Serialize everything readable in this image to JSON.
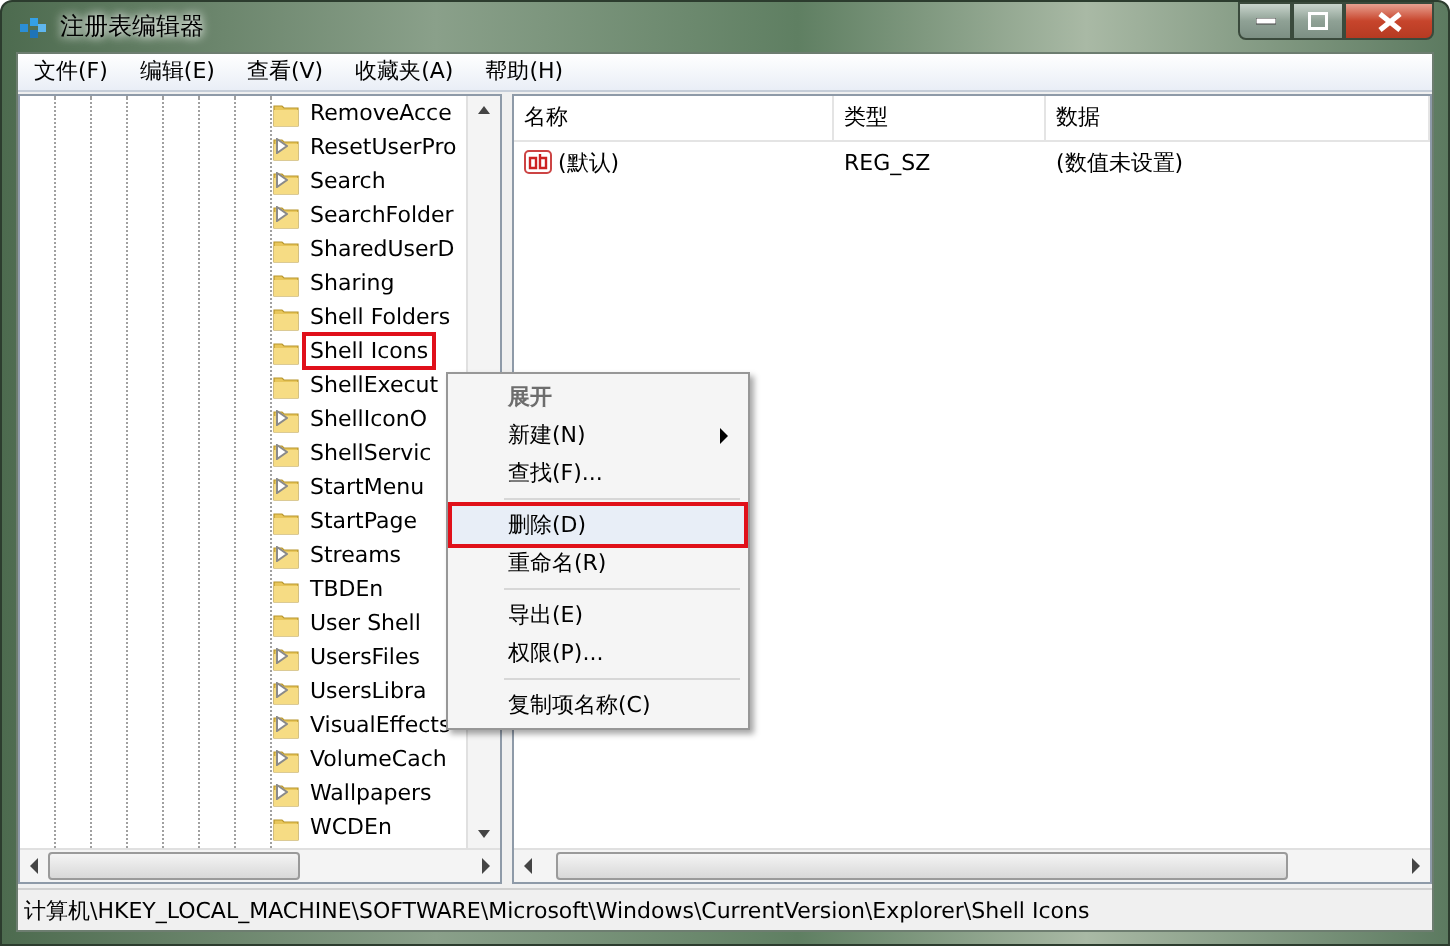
{
  "window": {
    "title": "注册表编辑器"
  },
  "menu_bar": [
    "文件(F)",
    "编辑(E)",
    "查看(V)",
    "收藏夹(A)",
    "帮助(H)"
  ],
  "tree": {
    "items": [
      {
        "label": "RemoveAcce",
        "expandable": false,
        "selected": false
      },
      {
        "label": "ResetUserPro",
        "expandable": true,
        "selected": false
      },
      {
        "label": "Search",
        "expandable": true,
        "selected": false
      },
      {
        "label": "SearchFolder",
        "expandable": true,
        "selected": false
      },
      {
        "label": "SharedUserD",
        "expandable": false,
        "selected": false
      },
      {
        "label": "Sharing",
        "expandable": false,
        "selected": false
      },
      {
        "label": "Shell Folders",
        "expandable": false,
        "selected": false
      },
      {
        "label": "Shell Icons",
        "expandable": false,
        "selected": true
      },
      {
        "label": "ShellExecut",
        "expandable": false,
        "selected": false
      },
      {
        "label": "ShellIconO",
        "expandable": true,
        "selected": false
      },
      {
        "label": "ShellServic",
        "expandable": true,
        "selected": false
      },
      {
        "label": "StartMenu",
        "expandable": true,
        "selected": false
      },
      {
        "label": "StartPage",
        "expandable": false,
        "selected": false
      },
      {
        "label": "Streams",
        "expandable": true,
        "selected": false
      },
      {
        "label": "TBDEn",
        "expandable": false,
        "selected": false
      },
      {
        "label": "User Shell",
        "expandable": false,
        "selected": false
      },
      {
        "label": "UsersFiles",
        "expandable": true,
        "selected": false
      },
      {
        "label": "UsersLibra",
        "expandable": true,
        "selected": false
      },
      {
        "label": "VisualEffects",
        "expandable": true,
        "selected": false
      },
      {
        "label": "VolumeCach",
        "expandable": true,
        "selected": false
      },
      {
        "label": "Wallpapers",
        "expandable": true,
        "selected": false
      },
      {
        "label": "WCDEn",
        "expandable": false,
        "selected": false
      }
    ]
  },
  "table": {
    "columns": [
      "名称",
      "类型",
      "数据"
    ],
    "rows": [
      {
        "cells": [
          "(默认)",
          "REG_SZ",
          "(数值未设置)"
        ]
      }
    ]
  },
  "context_menu": [
    {
      "kind": "item",
      "label": "展开",
      "disabled": true,
      "submenu": false,
      "selected": false
    },
    {
      "kind": "item",
      "label": "新建(N)",
      "disabled": false,
      "submenu": true,
      "selected": false
    },
    {
      "kind": "item",
      "label": "查找(F)...",
      "disabled": false,
      "submenu": false,
      "selected": false
    },
    {
      "kind": "separator"
    },
    {
      "kind": "item",
      "label": "删除(D)",
      "disabled": false,
      "submenu": false,
      "selected": true
    },
    {
      "kind": "item",
      "label": "重命名(R)",
      "disabled": false,
      "submenu": false,
      "selected": false
    },
    {
      "kind": "separator"
    },
    {
      "kind": "item",
      "label": "导出(E)",
      "disabled": false,
      "submenu": false,
      "selected": false
    },
    {
      "kind": "item",
      "label": "权限(P)...",
      "disabled": false,
      "submenu": false,
      "selected": false
    },
    {
      "kind": "separator"
    },
    {
      "kind": "item",
      "label": "复制项名称(C)",
      "disabled": false,
      "submenu": false,
      "selected": false
    }
  ],
  "status_bar": "计算机\\HKEY_LOCAL_MACHINE\\SOFTWARE\\Microsoft\\Windows\\CurrentVersion\\Explorer\\Shell Icons"
}
